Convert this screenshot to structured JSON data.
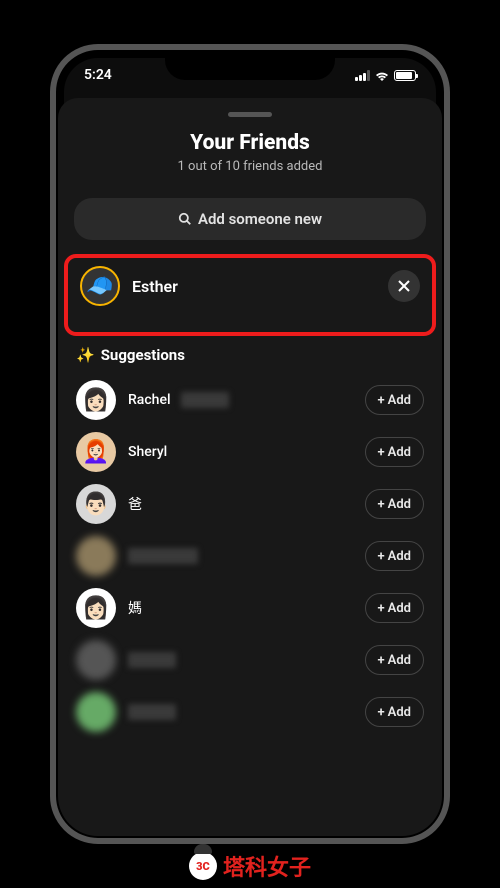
{
  "status": {
    "time": "5:24"
  },
  "header": {
    "title": "Your Friends",
    "subtitle": "1 out of 10 friends added"
  },
  "search": {
    "label": "Add someone new"
  },
  "friend": {
    "name": "Esther"
  },
  "suggestions": {
    "header": "Suggestions",
    "add_label": "Add",
    "items": [
      {
        "name": "Rachel",
        "blurred": true
      },
      {
        "name": "Sheryl",
        "blurred": false
      },
      {
        "name": "爸",
        "blurred": false
      },
      {
        "name": "",
        "blurred": true
      },
      {
        "name": "媽",
        "blurred": false
      },
      {
        "name": "",
        "blurred": true
      },
      {
        "name": "",
        "blurred": true
      }
    ]
  },
  "watermark": {
    "text": "塔科女子",
    "badge": "3C"
  }
}
